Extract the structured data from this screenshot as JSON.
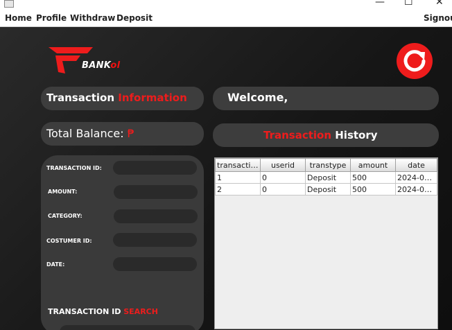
{
  "window": {
    "minimize_glyph": "—",
    "maximize_glyph": "☐",
    "close_glyph": "✕"
  },
  "menu": {
    "home": "Home",
    "profile": "Profile",
    "withdraw": "Withdraw",
    "deposit": "Deposit",
    "signout": "Signout"
  },
  "logo": {
    "text_white": "BANK",
    "text_red": "ol"
  },
  "icons": {
    "refresh": "refresh-icon",
    "logo": "bank-logo"
  },
  "colors": {
    "accent": "#ee1c1c",
    "background": "#1a1a1a",
    "panel": "#3d3d3d"
  },
  "info_heading": {
    "part1": "Transaction ",
    "part2": "Information"
  },
  "welcome": {
    "text": "Welcome,"
  },
  "balance": {
    "label": "Total Balance: ",
    "currency": "₱"
  },
  "history_heading": {
    "part1": "Transaction ",
    "part2": "History"
  },
  "form": {
    "transaction_id_label": "TRANSACTION ID:",
    "amount_label": "AMOUNT:",
    "category_label": "CATEGORY:",
    "customer_id_label": "COSTUMER ID:",
    "date_label": "DATE:",
    "search_label_part1": "TRANSACTION ID ",
    "search_label_part2": "SEARCH"
  },
  "table": {
    "columns": [
      "transactio...",
      "userid",
      "transtype",
      "amount",
      "date"
    ],
    "rows": [
      [
        "1",
        "0",
        "Deposit",
        "500",
        "2024-04-..."
      ],
      [
        "2",
        "0",
        "Deposit",
        "500",
        "2024-04-..."
      ]
    ]
  }
}
